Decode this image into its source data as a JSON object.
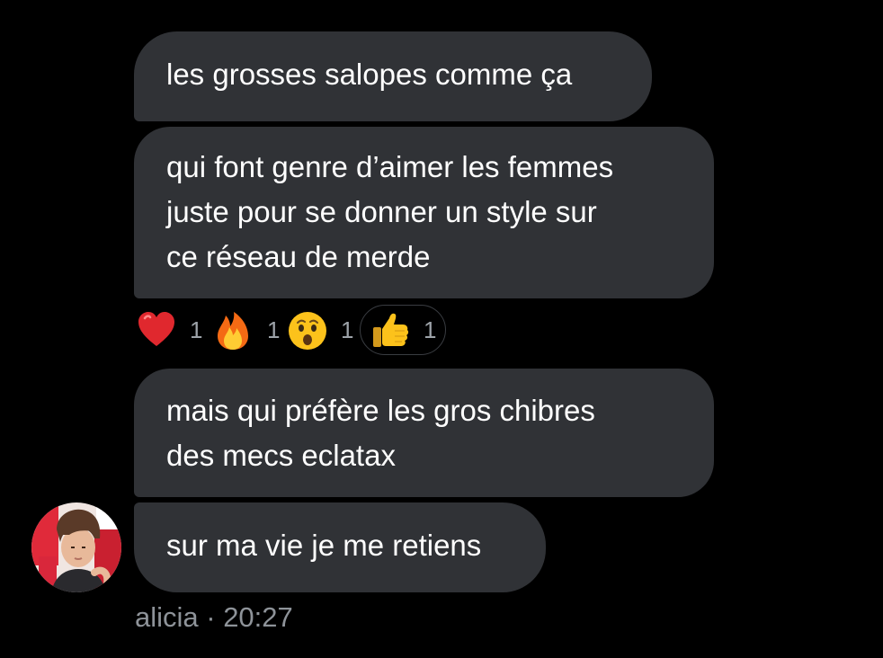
{
  "messages": [
    {
      "text": "les grosses salopes comme ça"
    },
    {
      "text": "qui font genre d’aimer les femmes\njuste pour se donner un style sur\nce réseau de merde"
    },
    {
      "text": "mais qui préfère les gros chibres\ndes mecs eclatax"
    },
    {
      "text": "sur ma vie je me retiens"
    }
  ],
  "reactions": [
    {
      "icon": "red-heart-emoji",
      "count": "1"
    },
    {
      "icon": "fire-emoji",
      "count": "1"
    },
    {
      "icon": "hushed-face-emoji",
      "count": "1"
    },
    {
      "icon": "thumbs-up-emoji",
      "count": "1",
      "selected": true
    }
  ],
  "sender": {
    "name": "alicia",
    "separator": "·",
    "time": "20:27",
    "meta": "alicia · 20:27"
  },
  "colors": {
    "background": "#000000",
    "bubble": "#303236",
    "text": "#ffffff",
    "muted": "#8e9399"
  }
}
